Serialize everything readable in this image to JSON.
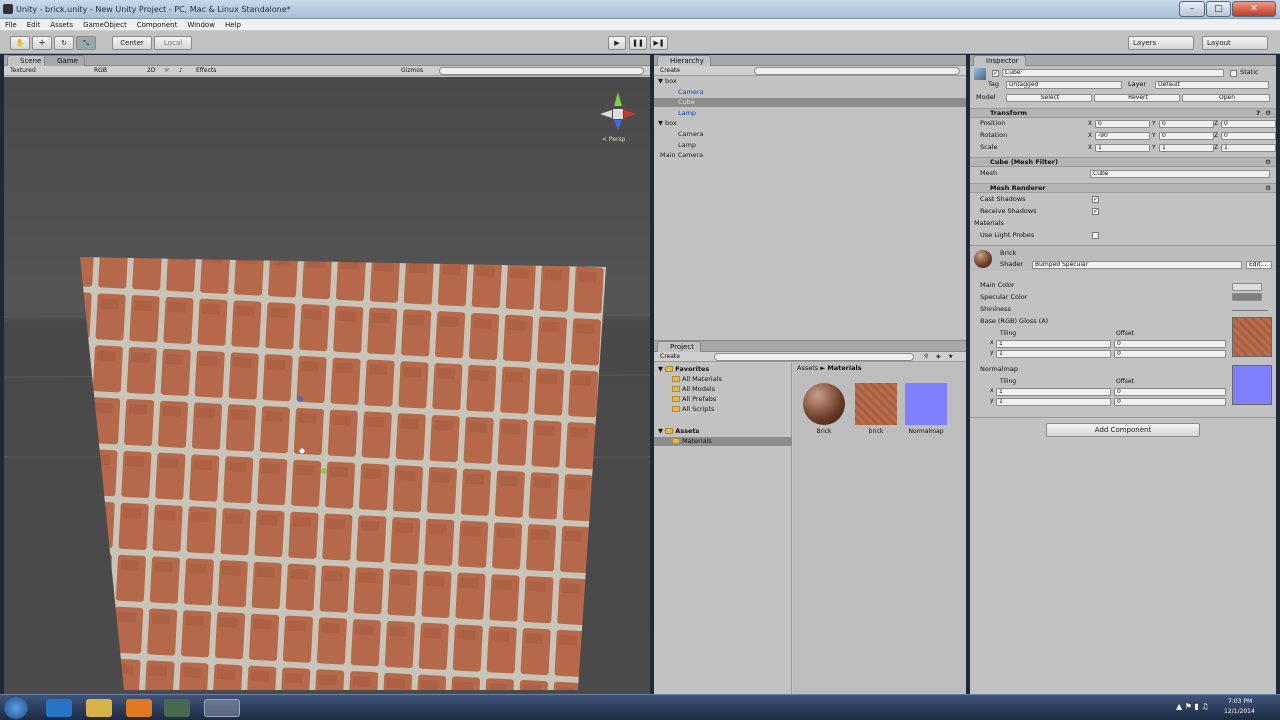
{
  "window": {
    "title": "Unity - brick.unity - New Unity Project - PC, Mac & Linux Standalone*",
    "min": "–",
    "max": "□",
    "close": "✕"
  },
  "menu": [
    "File",
    "Edit",
    "Assets",
    "GameObject",
    "Component",
    "Window",
    "Help"
  ],
  "toolbar": {
    "center": "Center",
    "local": "Local",
    "layers": "Layers",
    "layout": "Layout"
  },
  "scene": {
    "tabs": [
      "Scene",
      "Game"
    ],
    "shading": "Textured",
    "render_mode": "RGB",
    "toggle_2d": "2D",
    "effects": "Effects",
    "gizmos": "Gizmos",
    "persp": "< Persp"
  },
  "hierarchy": {
    "tab": "Hierarchy",
    "create": "Create",
    "items": [
      {
        "label": "box",
        "indent": 0,
        "color": "#222",
        "arrow": "▼"
      },
      {
        "label": "Camera",
        "indent": 1,
        "color": "#1f3fa8",
        "arrow": ""
      },
      {
        "label": "Cube",
        "indent": 1,
        "color": "#1f3fa8",
        "arrow": "",
        "selected": true
      },
      {
        "label": "Lamp",
        "indent": 1,
        "color": "#1f3fa8",
        "arrow": ""
      },
      {
        "label": "box",
        "indent": 0,
        "color": "#222",
        "arrow": "▼"
      },
      {
        "label": "Camera",
        "indent": 1,
        "color": "#222",
        "arrow": ""
      },
      {
        "label": "Lamp",
        "indent": 1,
        "color": "#222",
        "arrow": ""
      },
      {
        "label": "Main Camera",
        "indent": 0,
        "color": "#222",
        "arrow": ""
      }
    ]
  },
  "project": {
    "tab": "Project",
    "create": "Create",
    "favorites_label": "Favorites",
    "favorites": [
      "All Materials",
      "All Models",
      "All Prefabs",
      "All Scripts"
    ],
    "assets_label": "Assets",
    "assets_children": [
      "Materials"
    ],
    "breadcrumb_root": "Assets",
    "breadcrumb_sep": "►",
    "breadcrumb_leaf": "Materials",
    "items": [
      {
        "label": "Brick",
        "kind": "sphere"
      },
      {
        "label": "brick",
        "kind": "texture"
      },
      {
        "label": "Normalmap",
        "kind": "normal"
      }
    ]
  },
  "inspector": {
    "tab": "Inspector",
    "name": "Cube",
    "static": "Static",
    "tag_label": "Tag",
    "tag_value": "Untagged",
    "layer_label": "Layer",
    "layer_value": "Default",
    "model_label": "Model",
    "model_buttons": [
      "Select",
      "Revert",
      "Open"
    ],
    "transform": {
      "header": "Transform",
      "rows": [
        {
          "label": "Position",
          "x": "0",
          "y": "0",
          "z": "0"
        },
        {
          "label": "Rotation",
          "x": "-90",
          "y": "0",
          "z": "0"
        },
        {
          "label": "Scale",
          "x": "1",
          "y": "1",
          "z": "1"
        }
      ]
    },
    "mesh_filter": {
      "header": "Cube (Mesh Filter)",
      "mesh_label": "Mesh",
      "mesh_value": "Cube"
    },
    "mesh_renderer": {
      "header": "Mesh Renderer",
      "cast": "Cast Shadows",
      "receive": "Receive Shadows",
      "materials": "Materials",
      "probes": "Use Light Probes"
    },
    "material": {
      "name": "Brick",
      "shader_label": "Shader",
      "shader_value": "Bumped Specular",
      "edit": "Edit...",
      "props": [
        "Main Color",
        "Specular Color",
        "Shininess",
        "Base (RGB) Gloss (A)"
      ],
      "tiling": "Tiling",
      "offset": "Offset",
      "x": "x",
      "y": "y",
      "t1": "1",
      "t0": "0",
      "normal_label": "Normalmap"
    },
    "add_component": "Add Component"
  },
  "taskbar": {
    "time": "7:03 PM",
    "date": "12/1/2014"
  },
  "colors": {
    "accent": "#3e5fa8",
    "brick": "#b06846",
    "normal": "#7f7fff",
    "sel": "#8d8d8d"
  }
}
